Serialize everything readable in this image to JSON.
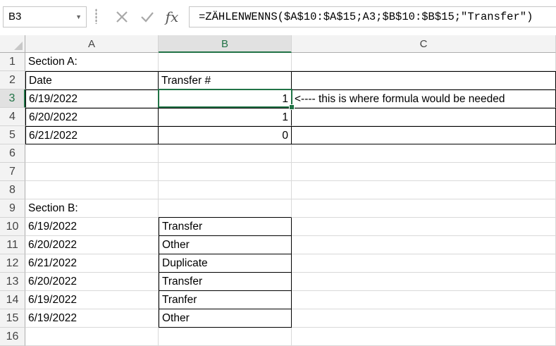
{
  "formula_bar": {
    "name_box": "B3",
    "fx_label": "fx",
    "formula": "=ZÄHLENWENNS($A$10:$A$15;A3;$B$10:$B$15;\"Transfer\")"
  },
  "columns": [
    "A",
    "B",
    "C"
  ],
  "rows": [
    {
      "n": "1",
      "a": "Section A:",
      "b": "",
      "c": ""
    },
    {
      "n": "2",
      "a": "Date",
      "b": "Transfer #",
      "c": ""
    },
    {
      "n": "3",
      "a": "6/19/2022",
      "b": "1",
      "c": "<---- this is where formula would be needed"
    },
    {
      "n": "4",
      "a": "6/20/2022",
      "b": "1",
      "c": ""
    },
    {
      "n": "5",
      "a": "6/21/2022",
      "b": "0",
      "c": ""
    },
    {
      "n": "6",
      "a": "",
      "b": "",
      "c": ""
    },
    {
      "n": "7",
      "a": "",
      "b": "",
      "c": ""
    },
    {
      "n": "8",
      "a": "",
      "b": "",
      "c": ""
    },
    {
      "n": "9",
      "a": "Section B:",
      "b": "",
      "c": ""
    },
    {
      "n": "10",
      "a": "6/19/2022",
      "b": "Transfer",
      "c": ""
    },
    {
      "n": "11",
      "a": "6/20/2022",
      "b": "Other",
      "c": ""
    },
    {
      "n": "12",
      "a": "6/21/2022",
      "b": "Duplicate",
      "c": ""
    },
    {
      "n": "13",
      "a": "6/20/2022",
      "b": "Transfer",
      "c": ""
    },
    {
      "n": "14",
      "a": "6/19/2022",
      "b": "Tranfer",
      "c": ""
    },
    {
      "n": "15",
      "a": "6/19/2022",
      "b": "Other",
      "c": ""
    },
    {
      "n": "16",
      "a": "",
      "b": "",
      "c": ""
    }
  ],
  "selection": {
    "column": "B",
    "row": "3"
  },
  "colors": {
    "accent": "#217346"
  }
}
